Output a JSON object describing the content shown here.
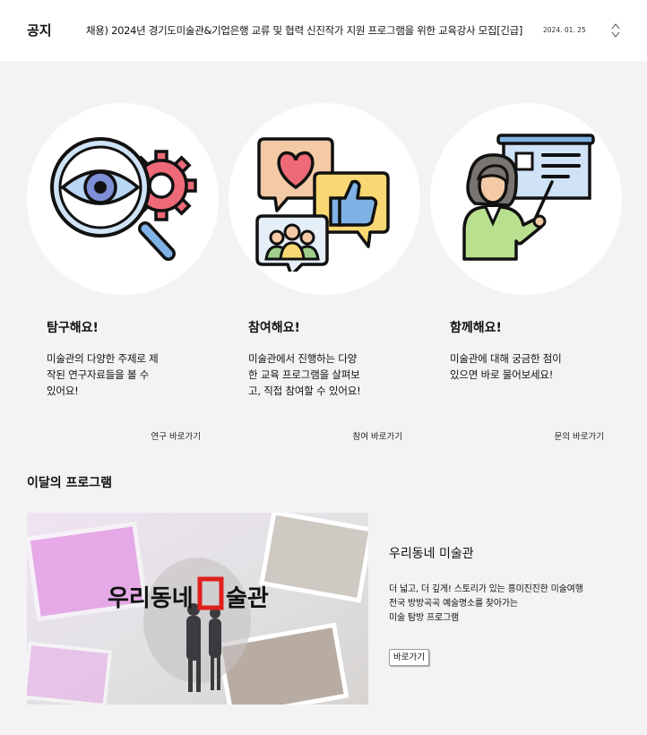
{
  "notice": {
    "label": "공지",
    "text": "채용) 2024년 경기도미술관&기업은행 교류 및 협력 신진작가 지원 프로그램을 위한 교육강사 모집[긴급]",
    "date": "2024. 01. 25",
    "icons": [
      "chevron-up-icon",
      "chevron-down-icon"
    ]
  },
  "cards": [
    {
      "icon": "magnifier-gear-icon",
      "title": "탐구해요!",
      "desc_lines": [
        "미술관의 다양한 주제로 제",
        "작된 연구자료들을 볼 수",
        "있어요!"
      ],
      "link": "연구 바로가기"
    },
    {
      "icon": "feedback-bubbles-icon",
      "title": "참여해요!",
      "desc_lines": [
        "미술관에서 진행하는 다양",
        "한 교육 프로그램을 살펴보",
        "고, 직접 참여할 수 있어요!"
      ],
      "link": "참여 바로가기"
    },
    {
      "icon": "teacher-board-icon",
      "title": "함께해요!",
      "desc_lines": [
        "미술관에 대해 궁금한 점이",
        "있으면 바로 물어보세요!"
      ],
      "link": "문의 바로가기"
    }
  ],
  "program": {
    "section_title": "이달의 프로그램",
    "image_text": "우리동네 미술관",
    "title": "우리동네 미술관",
    "desc_lines": [
      "더 넓고, 더 깊게! 스토리가 있는 흥미진진한 미술여행",
      "전국 방방곡곡 예술명소를 찾아가는",
      "미술 탐방 프로그램"
    ],
    "button_label": "바로가기"
  },
  "colors": {
    "background": "#f3f3f5",
    "accent_red": "#e0201e",
    "icon_blue": "#7fb2e5",
    "icon_pink": "#ee6a78",
    "icon_yellow": "#f9d873"
  }
}
